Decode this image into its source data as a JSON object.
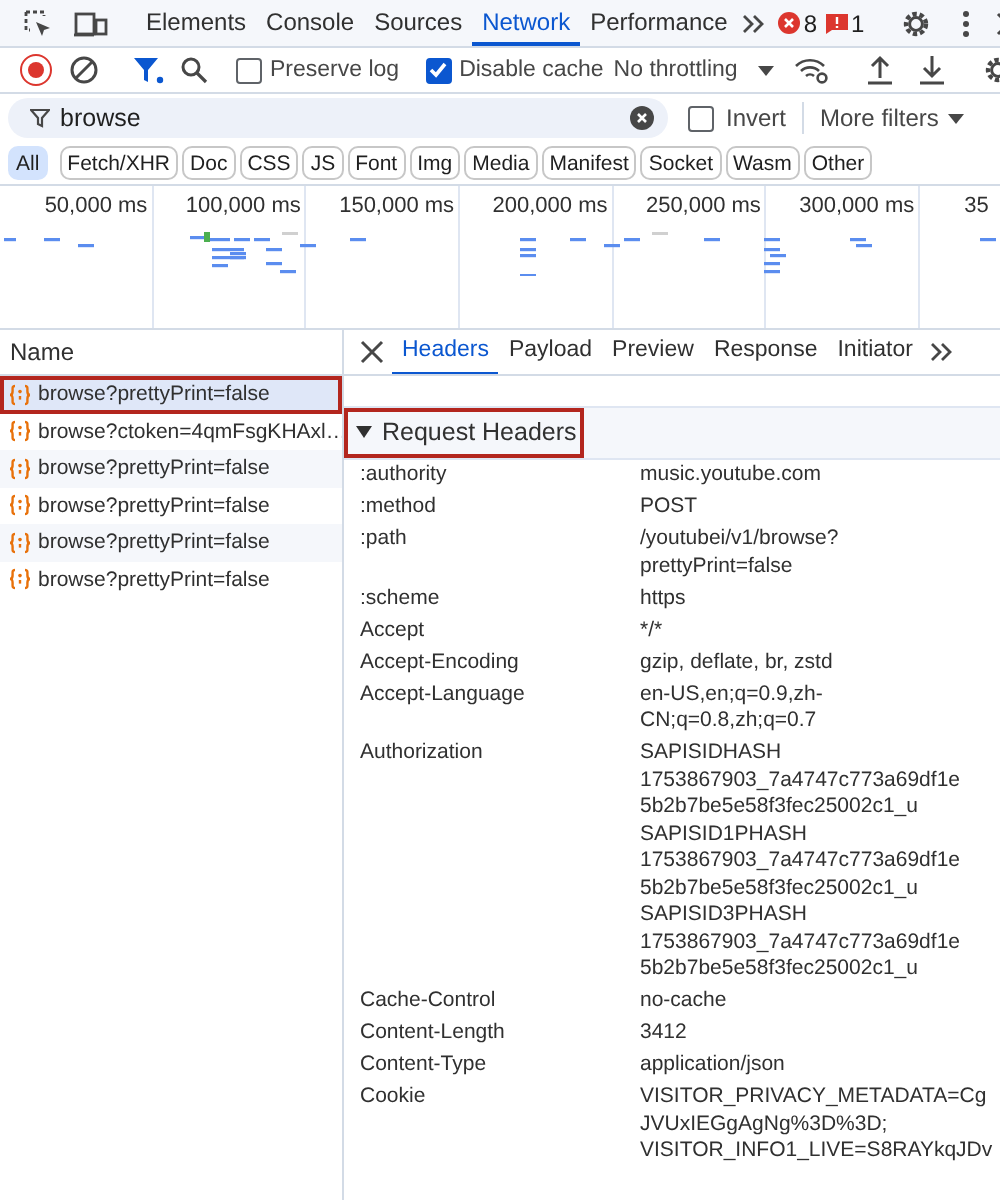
{
  "main_tabs": [
    {
      "label": "Elements",
      "selected": false
    },
    {
      "label": "Console",
      "selected": false
    },
    {
      "label": "Sources",
      "selected": false
    },
    {
      "label": "Network",
      "selected": true
    },
    {
      "label": "Performance",
      "selected": false
    }
  ],
  "badges": {
    "errors": "8",
    "issues": "1"
  },
  "controls": {
    "recording": true,
    "preserve_log": {
      "label": "Preserve log",
      "checked": false
    },
    "disable_cache": {
      "label": "Disable cache",
      "checked": true
    },
    "throttling": "No throttling"
  },
  "filter": {
    "value": "browse",
    "invert": {
      "label": "Invert",
      "checked": false
    },
    "more_filters": "More filters"
  },
  "type_filters": [
    {
      "label": "All",
      "selected": true
    },
    {
      "label": "Fetch/XHR",
      "selected": false
    },
    {
      "label": "Doc",
      "selected": false
    },
    {
      "label": "CSS",
      "selected": false
    },
    {
      "label": "JS",
      "selected": false
    },
    {
      "label": "Font",
      "selected": false
    },
    {
      "label": "Img",
      "selected": false
    },
    {
      "label": "Media",
      "selected": false
    },
    {
      "label": "Manifest",
      "selected": false
    },
    {
      "label": "Socket",
      "selected": false
    },
    {
      "label": "Wasm",
      "selected": false
    },
    {
      "label": "Other",
      "selected": false
    }
  ],
  "timeline": {
    "ticks": [
      "50,000 ms",
      "100,000 ms",
      "150,000 ms",
      "200,000 ms",
      "250,000 ms",
      "300,000 ms",
      "35"
    ]
  },
  "requests": {
    "column": "Name",
    "rows": [
      {
        "name": "browse?prettyPrint=false",
        "selected": true,
        "highlighted": true
      },
      {
        "name": "browse?ctoken=4qmFsgKHAxl…",
        "selected": false,
        "highlighted": false
      },
      {
        "name": "browse?prettyPrint=false",
        "selected": false,
        "highlighted": false
      },
      {
        "name": "browse?prettyPrint=false",
        "selected": false,
        "highlighted": false
      },
      {
        "name": "browse?prettyPrint=false",
        "selected": false,
        "highlighted": false
      },
      {
        "name": "browse?prettyPrint=false",
        "selected": false,
        "highlighted": false
      }
    ]
  },
  "detail_tabs": [
    {
      "label": "Headers",
      "selected": true
    },
    {
      "label": "Payload",
      "selected": false
    },
    {
      "label": "Preview",
      "selected": false
    },
    {
      "label": "Response",
      "selected": false
    },
    {
      "label": "Initiator",
      "selected": false
    }
  ],
  "section": {
    "title": "Request Headers",
    "expanded": true,
    "highlighted": true
  },
  "headers": [
    {
      "name": ":authority",
      "value": "music.youtube.com"
    },
    {
      "name": ":method",
      "value": "POST"
    },
    {
      "name": ":path",
      "value": "/youtubei/v1/browse?\nprettyPrint=false"
    },
    {
      "name": ":scheme",
      "value": "https"
    },
    {
      "name": "Accept",
      "value": "*/*"
    },
    {
      "name": "Accept-Encoding",
      "value": "gzip, deflate, br, zstd"
    },
    {
      "name": "Accept-Language",
      "value": "en-US,en;q=0.9,zh-\nCN;q=0.8,zh;q=0.7"
    },
    {
      "name": "Authorization",
      "value": "SAPISIDHASH\n1753867903_7a4747c773a69df1e\n5b2b7be5e58f3fec25002c1_u\nSAPISID1PHASH\n1753867903_7a4747c773a69df1e\n5b2b7be5e58f3fec25002c1_u\nSAPISID3PHASH\n1753867903_7a4747c773a69df1e\n5b2b7be5e58f3fec25002c1_u"
    },
    {
      "name": "Cache-Control",
      "value": "no-cache"
    },
    {
      "name": "Content-Length",
      "value": "3412"
    },
    {
      "name": "Content-Type",
      "value": "application/json"
    },
    {
      "name": "Cookie",
      "value": "VISITOR_PRIVACY_METADATA=Cg\nJVUxIEGgAgNg%3D%3D;\nVISITOR_INFO1_LIVE=S8RAYkqJDv"
    }
  ]
}
